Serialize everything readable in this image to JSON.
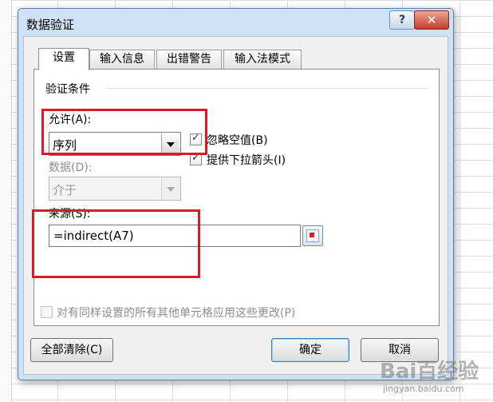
{
  "dialog": {
    "title": "数据验证",
    "help_label": "?",
    "close_label": "✕"
  },
  "tabs": [
    {
      "label": "设置",
      "active": true
    },
    {
      "label": "输入信息",
      "active": false
    },
    {
      "label": "出错警告",
      "active": false
    },
    {
      "label": "输入法模式",
      "active": false
    }
  ],
  "settings": {
    "group_title": "验证条件",
    "allow": {
      "label": "允许(A):",
      "value": "序列"
    },
    "data": {
      "label": "数据(D):",
      "value": "介于",
      "disabled": true
    },
    "ignore_blank": {
      "label": "忽略空值(B)",
      "checked": true
    },
    "dropdown": {
      "label": "提供下拉箭头(I)",
      "checked": true
    },
    "source": {
      "label": "来源(S):",
      "value": "=indirect(A7)"
    },
    "apply_all": {
      "label": "对有同样设置的所有其他单元格应用这些更改(P)",
      "checked": false,
      "disabled": true
    }
  },
  "buttons": {
    "clear_all": "全部清除(C)",
    "ok": "确定",
    "cancel": "取消"
  },
  "watermark": {
    "logo": "Bai百经验",
    "url": "jingyan.baidu.com"
  },
  "colors": {
    "annotation": "#d11f26",
    "dialog_frame": "#cfe1f4",
    "close_button": "#c2402c"
  }
}
